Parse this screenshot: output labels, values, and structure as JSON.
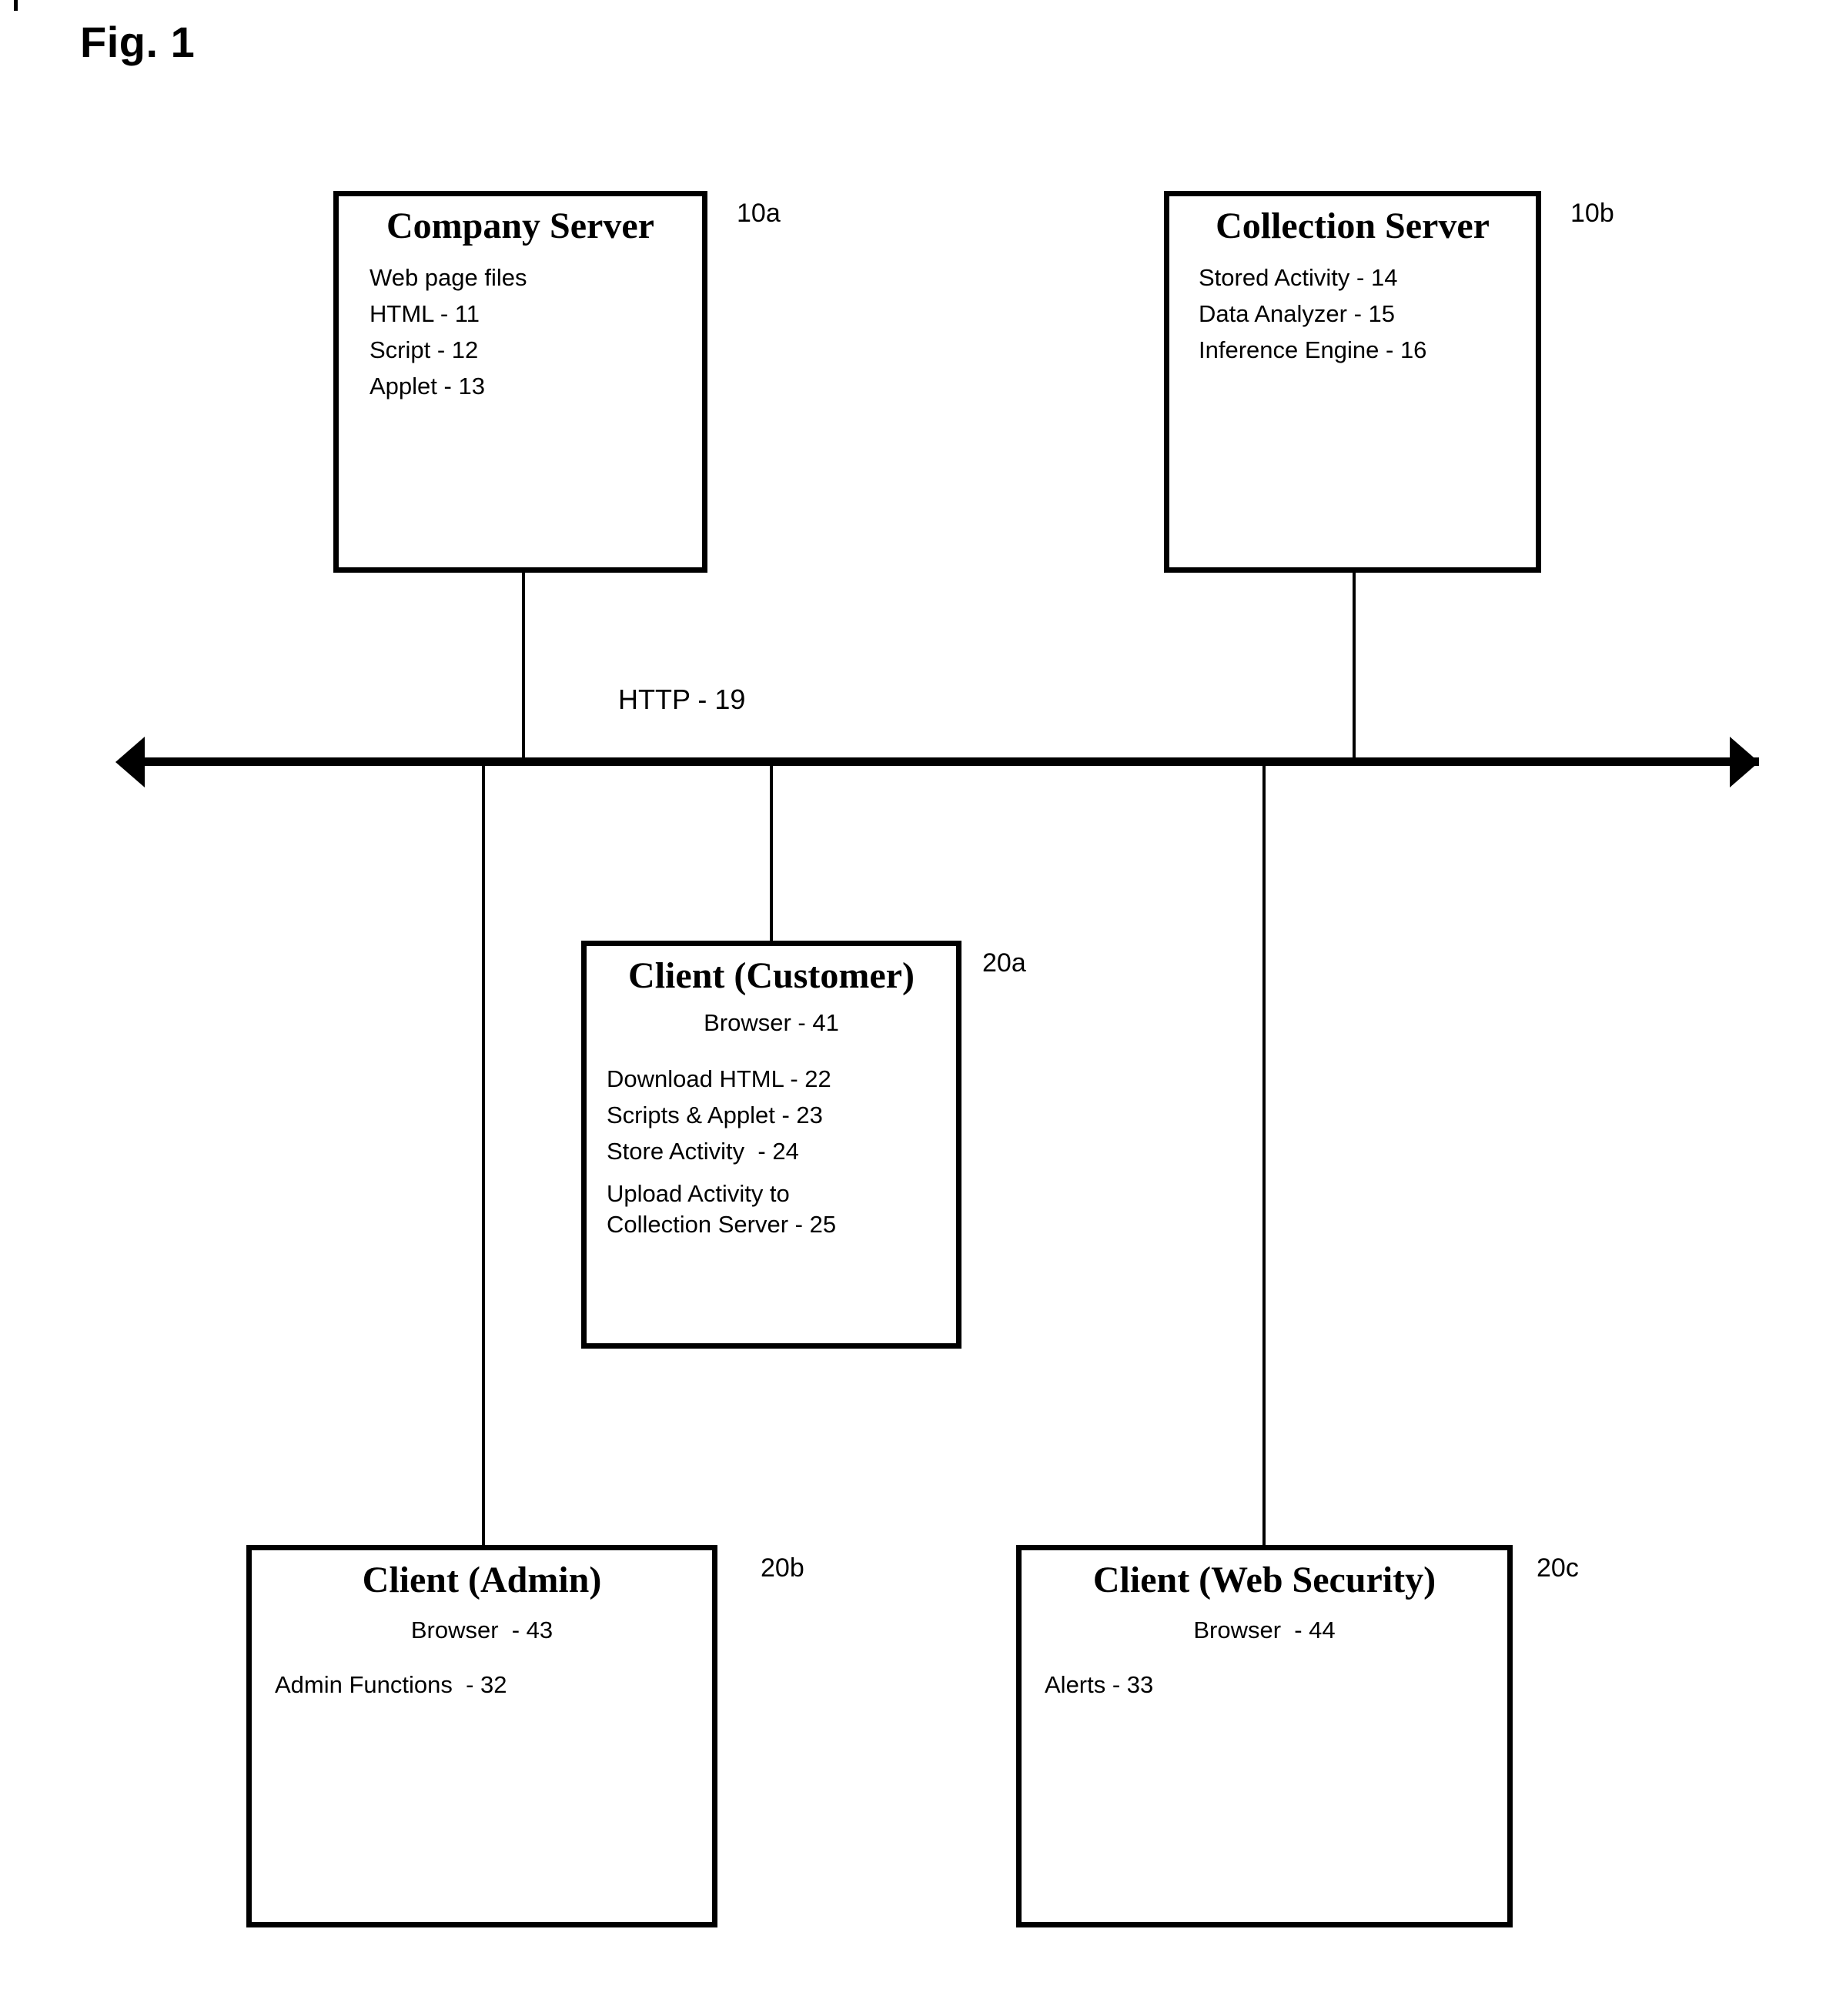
{
  "figure": {
    "caption": "Fig. 1"
  },
  "bus": {
    "label": "HTTP - 19"
  },
  "nodes": [
    {
      "id": "company-server",
      "title": "Company Server",
      "ref": "10a",
      "lines": [
        "Web page files",
        "HTML - 11",
        "Script - 12",
        "Applet - 13"
      ]
    },
    {
      "id": "collection-server",
      "title": "Collection Server",
      "ref": "10b",
      "lines": [
        "Stored Activity - 14",
        "Data Analyzer - 15",
        "Inference Engine - 16"
      ]
    },
    {
      "id": "client-customer",
      "title": "Client (Customer)",
      "ref": "20a",
      "lines": [
        "Browser - 41",
        "Download HTML - 22",
        "Scripts & Applet - 23",
        "Store Activity  - 24",
        "Upload Activity to",
        "Collection Server - 25"
      ]
    },
    {
      "id": "client-admin",
      "title": "Client (Admin)",
      "ref": "20b",
      "lines": [
        "Browser  - 43",
        "Admin Functions  - 32"
      ]
    },
    {
      "id": "client-web-security",
      "title": "Client (Web Security)",
      "ref": "20c",
      "lines": [
        "Browser  - 44",
        "Alerts - 33"
      ]
    }
  ],
  "colors": {
    "ink": "#000000",
    "paper": "#ffffff"
  }
}
